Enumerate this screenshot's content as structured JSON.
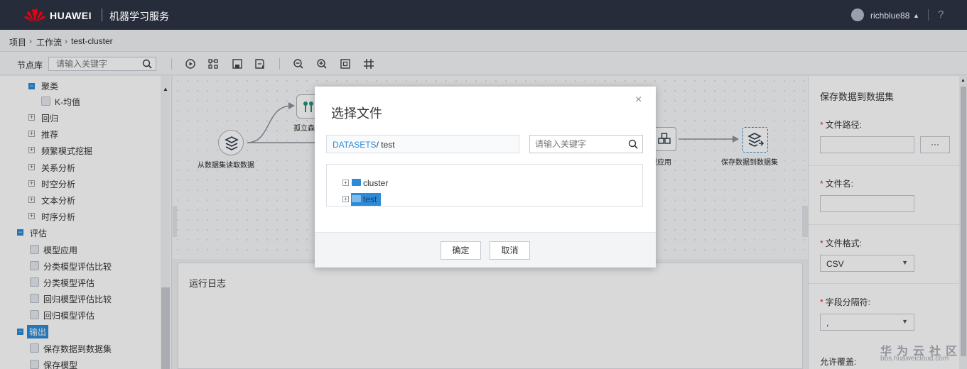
{
  "topbar": {
    "brand": "HUAWEI",
    "product": "机器学习服务",
    "username": "richblue88",
    "help": "?"
  },
  "breadcrumb": {
    "items": [
      "项目",
      "工作流",
      "test-cluster"
    ],
    "sep": "›"
  },
  "toolbar": {
    "nodelib_label": "节点库",
    "search_placeholder": "请输入关键字",
    "icons": [
      "run-icon",
      "layout-icon",
      "save-icon",
      "save-as-icon",
      "zoom-out-icon",
      "zoom-in-icon",
      "fit-icon",
      "grid-icon"
    ]
  },
  "sidebar": {
    "items": [
      {
        "label": "聚类",
        "type": "group-open"
      },
      {
        "label": "K-均值",
        "type": "leaf"
      },
      {
        "label": "回归",
        "type": "group"
      },
      {
        "label": "推荐",
        "type": "group"
      },
      {
        "label": "频繁模式挖掘",
        "type": "group"
      },
      {
        "label": "关系分析",
        "type": "group"
      },
      {
        "label": "时空分析",
        "type": "group"
      },
      {
        "label": "文本分析",
        "type": "group"
      },
      {
        "label": "时序分析",
        "type": "group"
      },
      {
        "label": "评估",
        "type": "top-open"
      },
      {
        "label": "模型应用",
        "type": "leaf"
      },
      {
        "label": "分类模型评估比较",
        "type": "leaf"
      },
      {
        "label": "分类模型评估",
        "type": "leaf"
      },
      {
        "label": "回归模型评估比较",
        "type": "leaf"
      },
      {
        "label": "回归模型评估",
        "type": "leaf"
      },
      {
        "label": "输出",
        "type": "top-open-selected"
      },
      {
        "label": "保存数据到数据集",
        "type": "leaf"
      },
      {
        "label": "保存模型",
        "type": "leaf"
      }
    ]
  },
  "canvas": {
    "nodes": {
      "source": "从数据集读取数据",
      "isolation": "孤立森",
      "apply": "型应用",
      "save": "保存数据到数据集"
    }
  },
  "runlog": {
    "title": "运行日志"
  },
  "rpanel": {
    "title": "保存数据到数据集",
    "file_path_label": "文件路径:",
    "browse": "···",
    "file_name_label": "文件名:",
    "file_format_label": "文件格式:",
    "file_format_value": "CSV",
    "delimiter_label": "字段分隔符:",
    "delimiter_value": ",",
    "overwrite_label": "允许覆盖:",
    "required_mark": "*"
  },
  "dialog": {
    "title": "选择文件",
    "close": "×",
    "path_root": "DATASETS",
    "path_rest": "/ test",
    "search_placeholder": "请输入关键字",
    "tree": [
      {
        "name": "cluster",
        "selected": false
      },
      {
        "name": "test",
        "selected": true
      }
    ],
    "ok": "确定",
    "cancel": "取消"
  },
  "watermark": {
    "line1": "华为云社区",
    "line2": "bbs.huaweicloud.com"
  },
  "colors": {
    "accent": "#2d8ad8",
    "topbar": "#262c3a",
    "required": "#e02d2d"
  }
}
